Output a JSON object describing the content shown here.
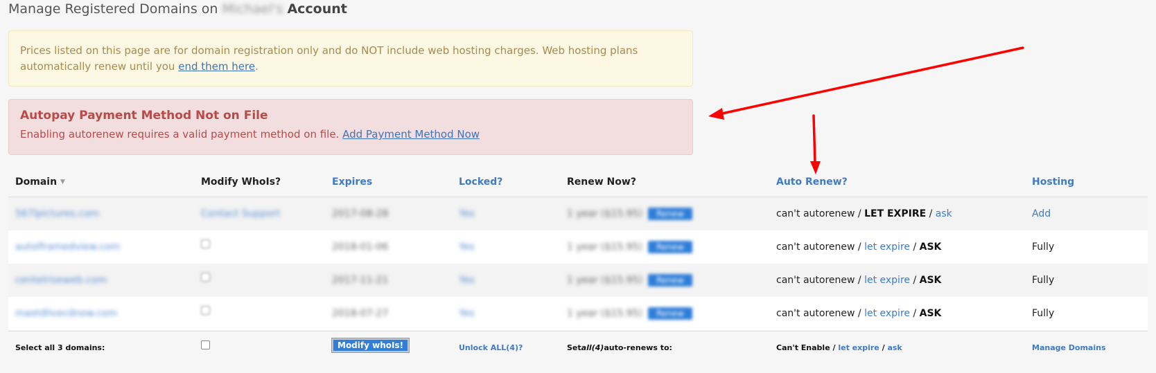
{
  "page": {
    "title_prefix": "Manage Registered Domains on",
    "title_owner": "Michael's",
    "title_suffix": "Account"
  },
  "notice": {
    "text": "Prices listed on this page are for domain registration only and do NOT include web hosting charges. Web hosting plans automatically renew until you",
    "link": "end them here",
    "end": "."
  },
  "alert": {
    "heading": "Autopay Payment Method Not on File",
    "text": "Enabling autorenew requires a valid payment method on file.",
    "link": "Add Payment Method Now"
  },
  "table": {
    "headers": {
      "domain": "Domain",
      "whois": "Modify WhoIs?",
      "expires": "Expires",
      "locked": "Locked?",
      "renew": "Renew Now?",
      "auto": "Auto Renew?",
      "hosting": "Hosting"
    },
    "rows": [
      {
        "domain": "567lpictures.com",
        "whois": "Contact Support",
        "whois_type": "link",
        "expires": "2017-08-28",
        "locked": "Yes",
        "renew_select": "1 year ($15.95)",
        "renew_button": "Renew",
        "auto_prefix": "can't autorenew",
        "auto_expire": "LET EXPIRE",
        "auto_expire_active": true,
        "auto_ask": "ask",
        "auto_ask_active": false,
        "hosting": "Add",
        "hosting_link": true
      },
      {
        "domain": "autolframedview.com",
        "whois": "",
        "whois_type": "checkbox",
        "expires": "2018-01-06",
        "locked": "Yes",
        "renew_select": "1 year ($15.95)",
        "renew_button": "Renew",
        "auto_prefix": "can't autorenew",
        "auto_expire": "let expire",
        "auto_expire_active": false,
        "auto_ask": "ASK",
        "auto_ask_active": true,
        "hosting": "Fully",
        "hosting_link": false
      },
      {
        "domain": "centelriseweb.com",
        "whois": "",
        "whois_type": "checkbox",
        "expires": "2017-11-21",
        "locked": "Yes",
        "renew_select": "1 year ($15.95)",
        "renew_button": "Renew",
        "auto_prefix": "can't autorenew",
        "auto_expire": "let expire",
        "auto_expire_active": false,
        "auto_ask": "ASK",
        "auto_ask_active": true,
        "hosting": "Fully",
        "hosting_link": false
      },
      {
        "domain": "mastdlivecdnow.com",
        "whois": "",
        "whois_type": "checkbox",
        "expires": "2018-07-27",
        "locked": "Yes",
        "renew_select": "1 year ($15.95)",
        "renew_button": "Renew",
        "auto_prefix": "can't autorenew",
        "auto_expire": "let expire",
        "auto_expire_active": false,
        "auto_ask": "ASK",
        "auto_ask_active": true,
        "hosting": "Fully",
        "hosting_link": false
      }
    ],
    "footer": {
      "select_all": "Select all 3 domains:",
      "modify_whois_button": "Modify whoIs!",
      "unlock_all": "Unlock ALL(4)?",
      "set_prefix": "Set ",
      "set_all": "all(4)",
      "set_suffix": " auto-renews to:",
      "cant_enable": "Can't Enable",
      "let_expire": "let expire",
      "ask": "ask",
      "manage_domains": "Manage Domains"
    }
  },
  "colors": {
    "link": "#3e7bc4",
    "annotation_arrow": "#ff0000",
    "alert_text": "#b94a48",
    "notice_text": "#a88a4f"
  }
}
